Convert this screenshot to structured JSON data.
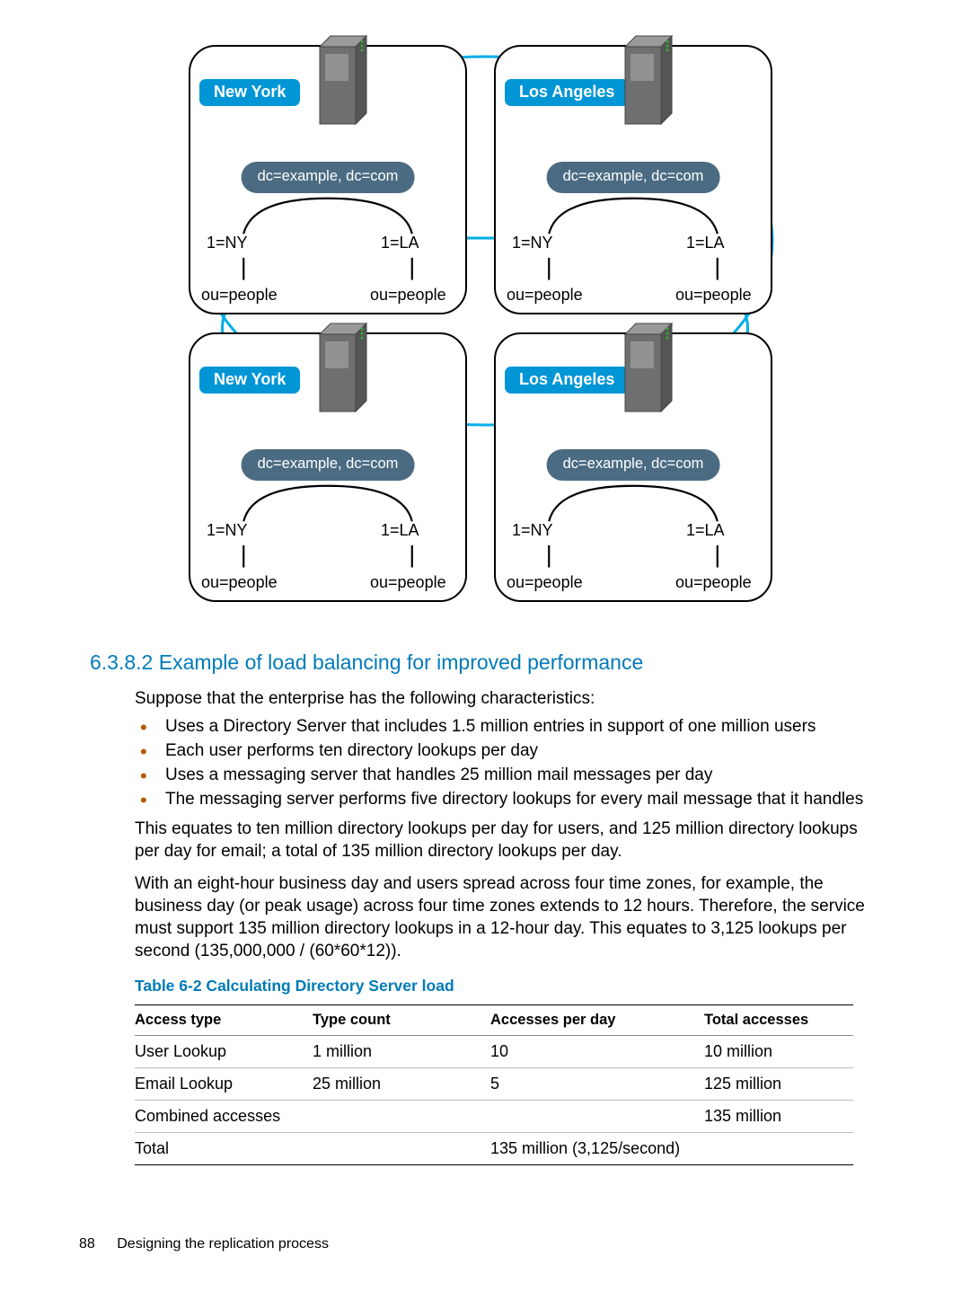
{
  "diagram": {
    "servers": [
      {
        "pos": "tl",
        "label": "New York",
        "dc": "dc=example, dc=com",
        "left": "1=NY",
        "right": "1=LA",
        "ou": "ou=people"
      },
      {
        "pos": "tr",
        "label": "Los Angeles",
        "dc": "dc=example, dc=com",
        "left": "1=NY",
        "right": "1=LA",
        "ou": "ou=people"
      },
      {
        "pos": "bl",
        "label": "New York",
        "dc": "dc=example, dc=com",
        "left": "1=NY",
        "right": "1=LA",
        "ou": "ou=people"
      },
      {
        "pos": "br",
        "label": "Los Angeles",
        "dc": "dc=example, dc=com",
        "left": "1=NY",
        "right": "1=LA",
        "ou": "ou=people"
      }
    ]
  },
  "heading": "6.3.8.2 Example of load balancing for improved performance",
  "intro": "Suppose that the enterprise has the following characteristics:",
  "bullets": [
    "Uses a Directory Server that includes 1.5 million entries in support of one million users",
    "Each user performs ten directory lookups per day",
    "Uses a messaging server that handles 25 million mail messages per day",
    "The messaging server performs five directory lookups for every mail message that it handles"
  ],
  "para2": "This equates to ten million directory lookups per day for users, and 125 million directory lookups per day for email; a total of 135 million directory lookups per day.",
  "para3": "With an eight-hour business day and users spread across four time zones, for example, the business day (or peak usage) across four time zones extends to 12 hours. Therefore, the service must support 135 million directory lookups in a 12-hour day. This equates to 3,125 lookups per second (135,000,000 / (60*60*12)).",
  "table": {
    "caption": "Table 6-2 Calculating Directory Server load",
    "headers": [
      "Access type",
      "Type count",
      "Accesses per day",
      "Total accesses"
    ],
    "rows": [
      [
        "User Lookup",
        "1 million",
        "10",
        "10 million"
      ],
      [
        "Email Lookup",
        "25 million",
        "5",
        "125 million"
      ],
      [
        "Combined accesses",
        "",
        "",
        "135 million"
      ],
      [
        "Total",
        "",
        "135 million (3,125/second)",
        ""
      ]
    ]
  },
  "footer": {
    "page": "88",
    "title": "Designing the replication process"
  }
}
